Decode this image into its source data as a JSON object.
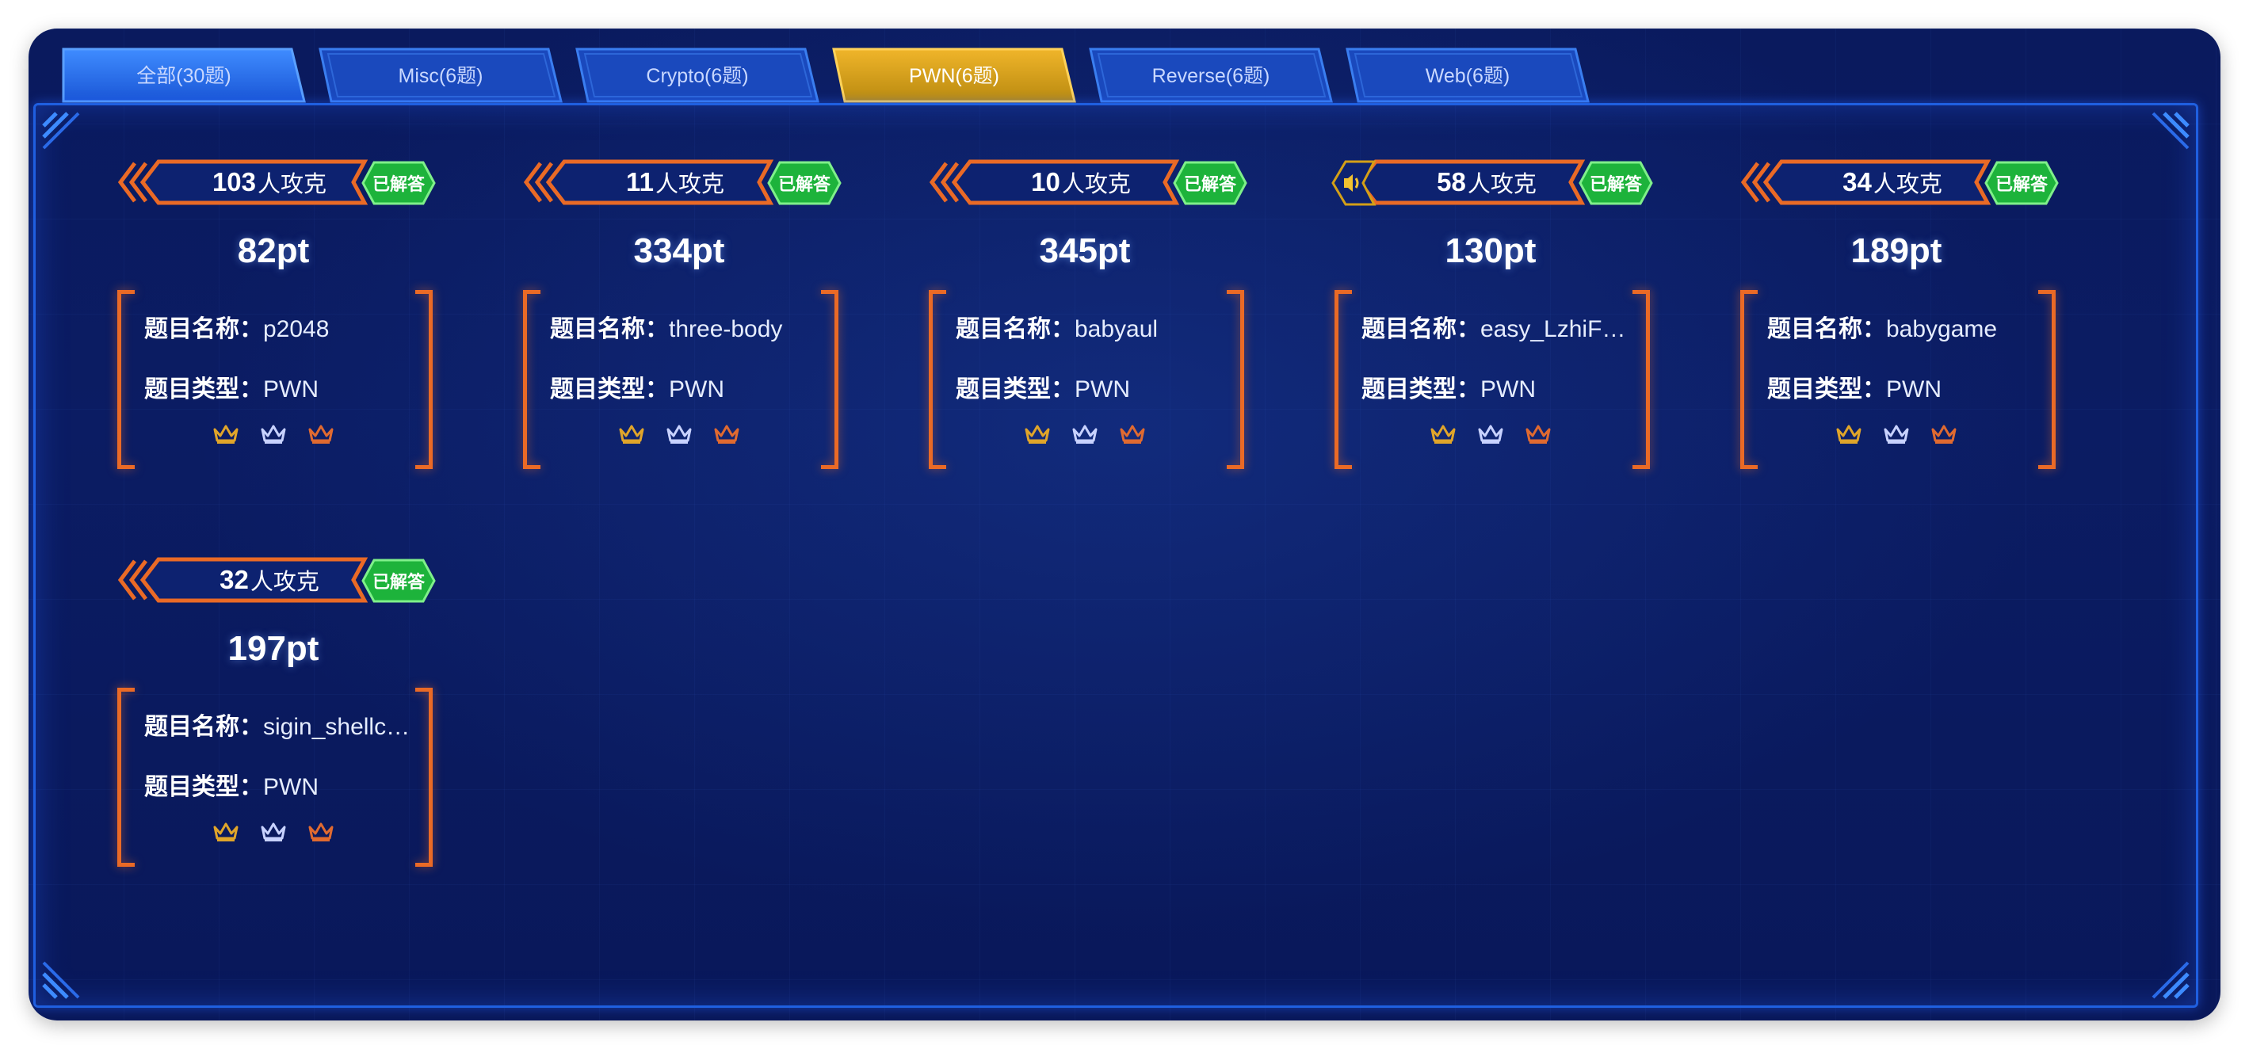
{
  "tabs": [
    {
      "label": "全部(30题)",
      "active": false
    },
    {
      "label": "Misc(6题)",
      "active": false
    },
    {
      "label": "Crypto(6题)",
      "active": false
    },
    {
      "label": "PWN(6题)",
      "active": true
    },
    {
      "label": "Reverse(6题)",
      "active": false
    },
    {
      "label": "Web(6题)",
      "active": false
    }
  ],
  "labels": {
    "solvers_suffix": "人攻克",
    "solved_badge": "已解答",
    "name_label": "题目名称：",
    "type_label": "题目类型："
  },
  "challenges": [
    {
      "solvers": "103",
      "points": "82pt",
      "name": "p2048",
      "type": "PWN",
      "has_speaker": false
    },
    {
      "solvers": "11",
      "points": "334pt",
      "name": "three-body",
      "type": "PWN",
      "has_speaker": false
    },
    {
      "solvers": "10",
      "points": "345pt",
      "name": "babyaul",
      "type": "PWN",
      "has_speaker": false
    },
    {
      "solvers": "58",
      "points": "130pt",
      "name": "easy_LzhiFT…",
      "type": "PWN",
      "has_speaker": true
    },
    {
      "solvers": "34",
      "points": "189pt",
      "name": "babygame",
      "type": "PWN",
      "has_speaker": false
    },
    {
      "solvers": "32",
      "points": "197pt",
      "name": "sigin_shellcode",
      "type": "PWN",
      "has_speaker": false
    }
  ],
  "colors": {
    "background": "#0a1a5e",
    "tab": "#1a4fc4",
    "tab_first": "#2a7af0",
    "tab_active": "#d4a017",
    "bracket": "#ea6a26",
    "solved_badge": "#1db33b",
    "crown_gold": "#e0a52a",
    "crown_silver": "#c8d2ff",
    "crown_bronze": "#e06a30"
  },
  "icons": {
    "crowns": [
      "crown-gold-icon",
      "crown-silver-icon",
      "crown-bronze-icon"
    ],
    "speaker": "speaker-icon",
    "back_arrows": "double-chevron-left-icon"
  }
}
